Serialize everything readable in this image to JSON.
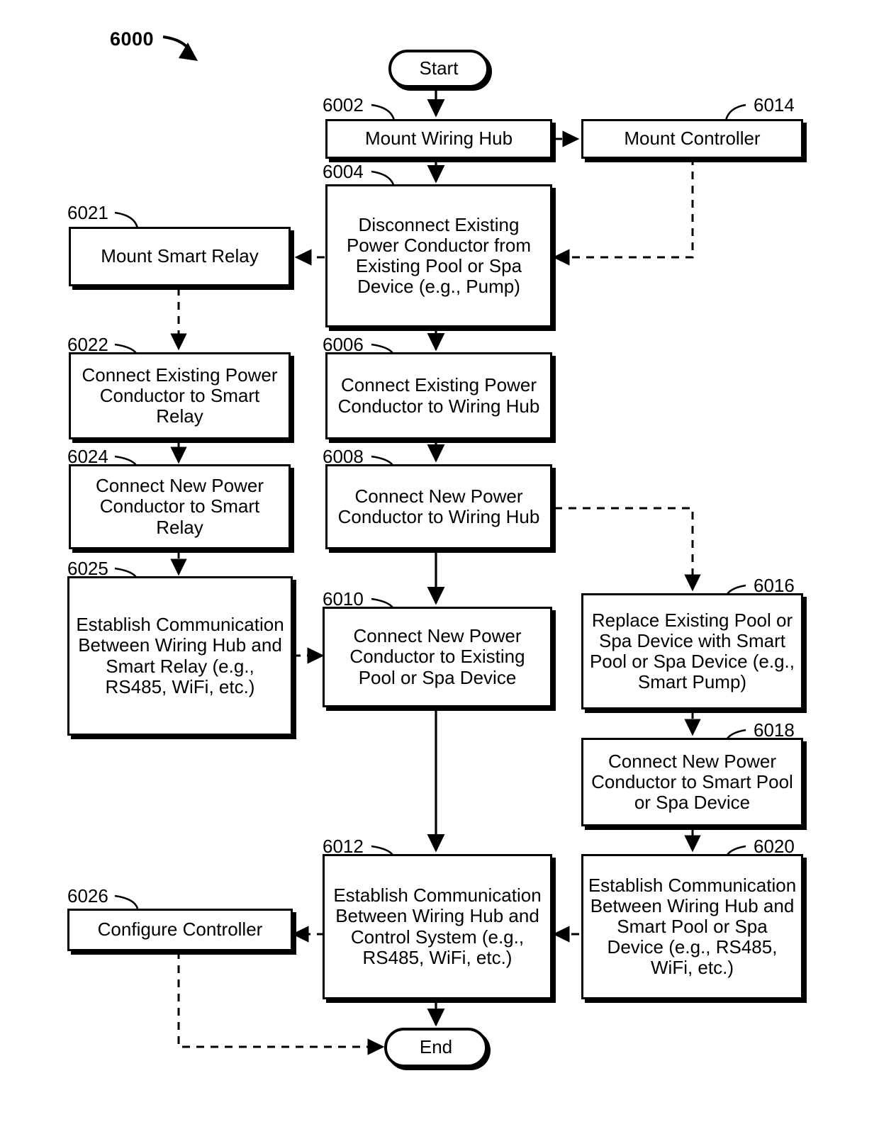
{
  "figure": {
    "number": "6000"
  },
  "nodes": {
    "start": {
      "ref": "",
      "label": "Start"
    },
    "end": {
      "ref": "",
      "label": "End"
    },
    "n6002": {
      "ref": "6002",
      "label": "Mount Wiring Hub"
    },
    "n6004": {
      "ref": "6004",
      "label": "Disconnect Existing Power Conductor from Existing Pool or Spa Device (e.g., Pump)"
    },
    "n6006": {
      "ref": "6006",
      "label": "Connect Existing Power Conductor to Wiring Hub"
    },
    "n6008": {
      "ref": "6008",
      "label": "Connect New Power Conductor to Wiring Hub"
    },
    "n6010": {
      "ref": "6010",
      "label": "Connect New Power Conductor to Existing Pool or Spa Device"
    },
    "n6012": {
      "ref": "6012",
      "label": "Establish Communication Between Wiring Hub and Control System (e.g., RS485, WiFi, etc.)"
    },
    "n6014": {
      "ref": "6014",
      "label": "Mount Controller"
    },
    "n6016": {
      "ref": "6016",
      "label": "Replace Existing Pool or Spa Device with Smart Pool or Spa Device (e.g., Smart Pump)"
    },
    "n6018": {
      "ref": "6018",
      "label": "Connect New Power Conductor to Smart Pool or Spa Device"
    },
    "n6020": {
      "ref": "6020",
      "label": "Establish Communication Between Wiring Hub and Smart Pool or Spa Device (e.g., RS485, WiFi, etc.)"
    },
    "n6021": {
      "ref": "6021",
      "label": "Mount Smart Relay"
    },
    "n6022": {
      "ref": "6022",
      "label": "Connect Existing Power Conductor to Smart Relay"
    },
    "n6024": {
      "ref": "6024",
      "label": "Connect New Power Conductor to Smart Relay"
    },
    "n6025": {
      "ref": "6025",
      "label": "Establish Communication Between Wiring Hub and Smart Relay (e.g., RS485, WiFi, etc.)"
    },
    "n6026": {
      "ref": "6026",
      "label": "Configure Controller"
    }
  },
  "colors": {
    "stroke": "#000000",
    "fill": "#ffffff"
  }
}
